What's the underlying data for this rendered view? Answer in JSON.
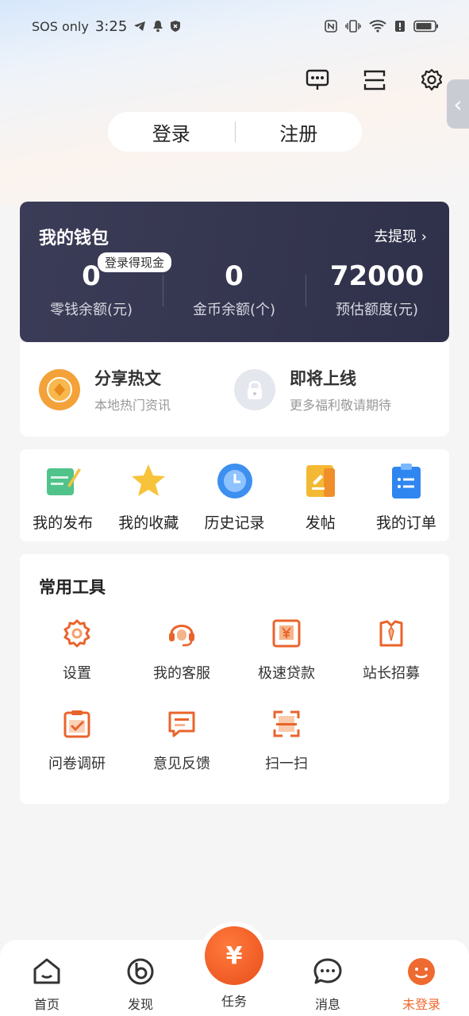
{
  "status_bar": {
    "carrier": "SOS only",
    "time": "3:25"
  },
  "auth": {
    "login": "登录",
    "register": "注册"
  },
  "wallet": {
    "title": "我的钱包",
    "withdraw": "去提现",
    "badge": "登录得现金",
    "balances": [
      {
        "value": "0",
        "label": "零钱余额(元)"
      },
      {
        "value": "0",
        "label": "金币余额(个)"
      },
      {
        "value": "72000",
        "label": "预估额度(元)"
      }
    ]
  },
  "promo": [
    {
      "title": "分享热文",
      "subtitle": "本地热门资讯"
    },
    {
      "title": "即将上线",
      "subtitle": "更多福利敬请期待"
    }
  ],
  "quick": [
    {
      "label": "我的发布",
      "icon": "edit-note-icon"
    },
    {
      "label": "我的收藏",
      "icon": "star-icon"
    },
    {
      "label": "历史记录",
      "icon": "clock-icon"
    },
    {
      "label": "发帖",
      "icon": "post-icon"
    },
    {
      "label": "我的订单",
      "icon": "order-icon"
    }
  ],
  "tools": {
    "title": "常用工具",
    "items": [
      {
        "label": "设置",
        "icon": "gear-icon"
      },
      {
        "label": "我的客服",
        "icon": "headset-icon"
      },
      {
        "label": "极速贷款",
        "icon": "loan-icon"
      },
      {
        "label": "站长招募",
        "icon": "recruit-icon"
      },
      {
        "label": "问卷调研",
        "icon": "survey-icon"
      },
      {
        "label": "意见反馈",
        "icon": "feedback-icon"
      },
      {
        "label": "扫一扫",
        "icon": "scan-icon"
      }
    ]
  },
  "tabbar": {
    "home": "首页",
    "discover": "发现",
    "task": "任务",
    "messages": "消息",
    "profile": "未登录",
    "center_symbol": "¥"
  },
  "colors": {
    "accent": "#ee6a30",
    "wallet_bg": "#34354f",
    "tool_icon": "#e9642c"
  }
}
